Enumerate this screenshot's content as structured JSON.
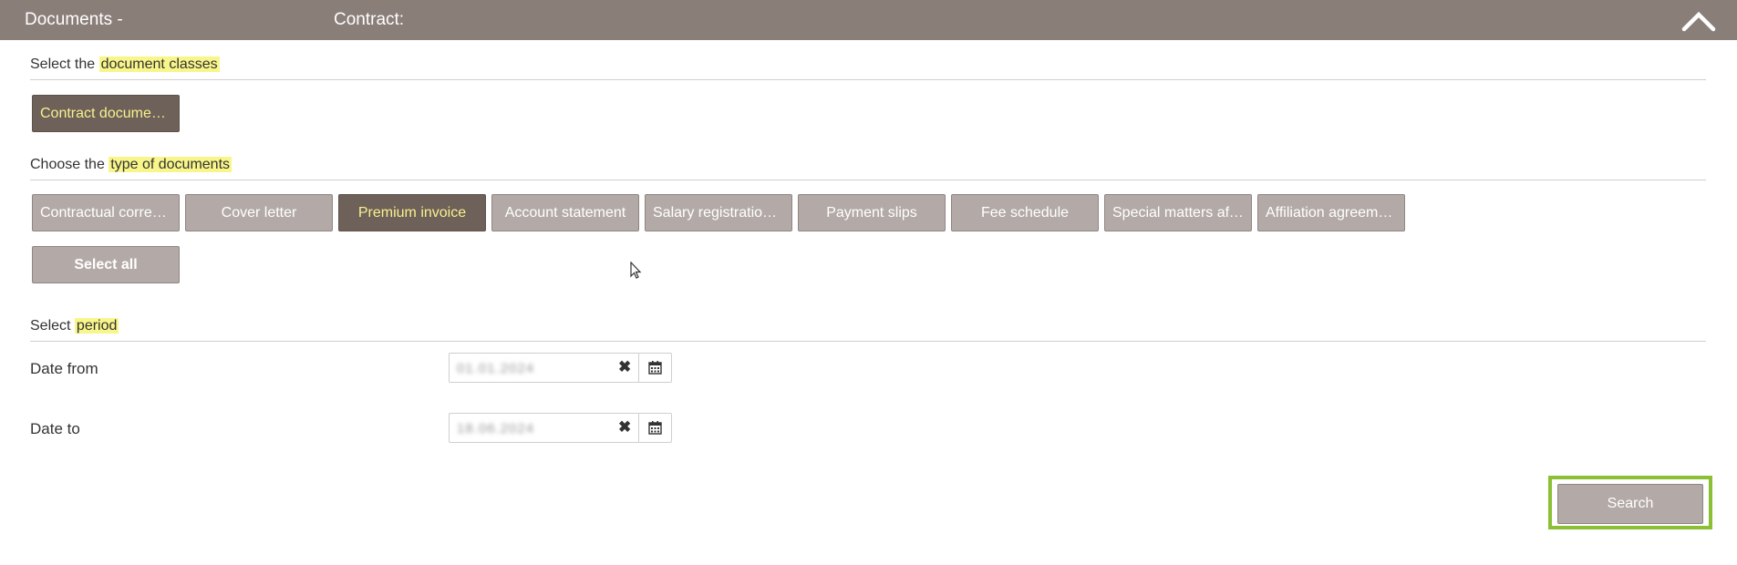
{
  "header": {
    "documents_label": "Documents -",
    "contract_label": "Contract:",
    "collapse_icon": "chevron-up-icon"
  },
  "document_classes": {
    "title_prefix": "Select the ",
    "title_highlight": "document classes",
    "buttons": [
      {
        "label": "Contract documen...",
        "selected": true
      }
    ]
  },
  "document_types": {
    "title_prefix": "Choose the ",
    "title_highlight": "type of documents",
    "buttons": [
      {
        "label": "Contractual corres...",
        "selected": false
      },
      {
        "label": "Cover letter",
        "selected": false
      },
      {
        "label": "Premium invoice",
        "selected": true
      },
      {
        "label": "Account statement",
        "selected": false
      },
      {
        "label": "Salary registration ...",
        "selected": false
      },
      {
        "label": "Payment slips",
        "selected": false
      },
      {
        "label": "Fee schedule",
        "selected": false
      },
      {
        "label": "Special matters aff...",
        "selected": false
      },
      {
        "label": "Affiliation agreeme...",
        "selected": false
      }
    ],
    "select_all_label": "Select all"
  },
  "period": {
    "title_prefix": "Select ",
    "title_highlight": "period",
    "date_from": {
      "label": "Date from",
      "value": "01.01.2024"
    },
    "date_to": {
      "label": "Date to",
      "value": "18.06.2024"
    }
  },
  "actions": {
    "search_label": "Search"
  },
  "colors": {
    "header_bg": "#8a7e79",
    "button_bg": "#b3aaa7",
    "button_selected_bg": "#6e6159",
    "button_selected_text": "#f8f08f",
    "highlight": "#f8f68a",
    "focus_outline": "#8bc034"
  }
}
